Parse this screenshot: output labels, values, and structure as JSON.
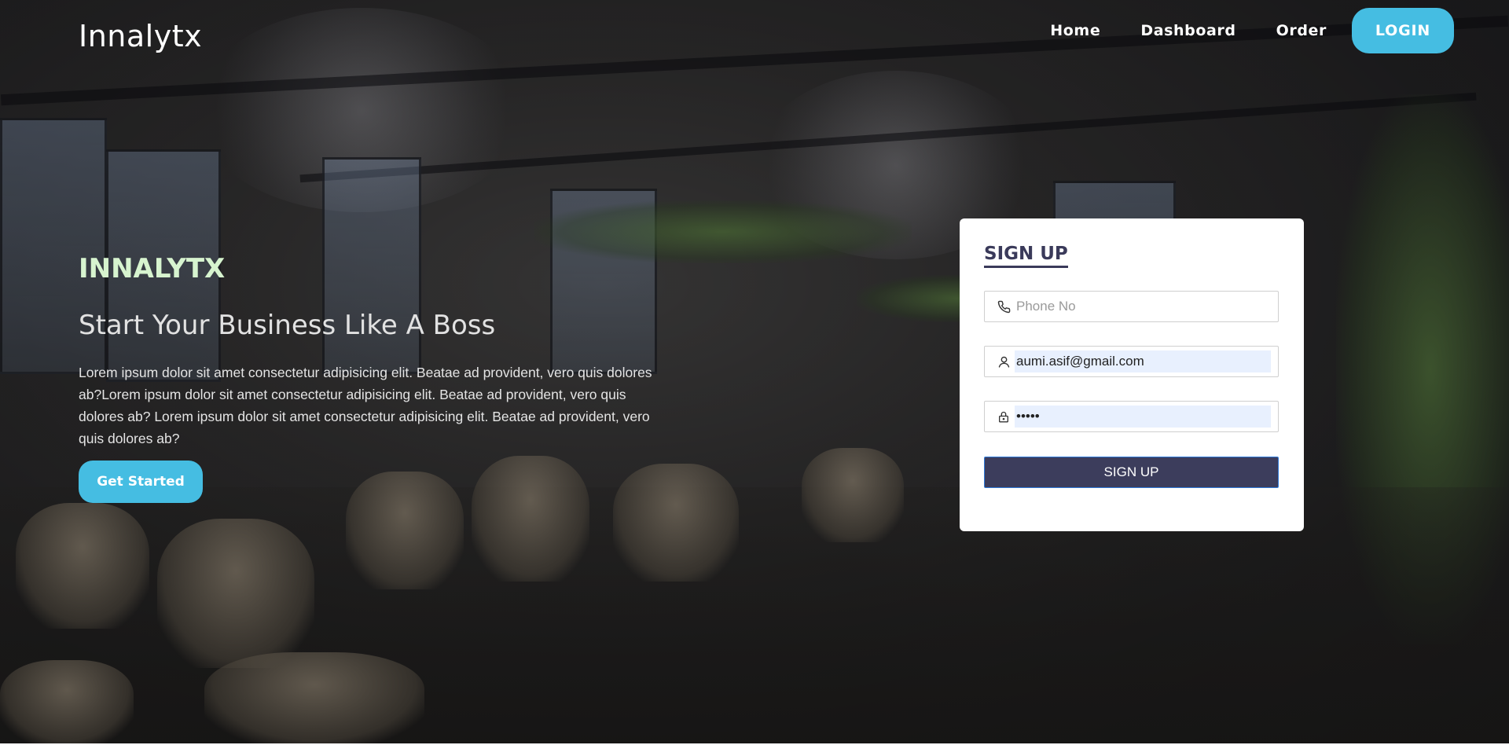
{
  "nav": {
    "logo": "Innalytx",
    "links": [
      "Home",
      "Dashboard",
      "Order"
    ],
    "login_label": "LOGIN"
  },
  "hero": {
    "brand": "INNALYTX",
    "headline": "Start Your Business Like A Boss",
    "body": "Lorem ipsum dolor sit amet consectetur adipisicing elit. Beatae ad provident, vero quis dolores ab?Lorem ipsum dolor sit amet consectetur adipisicing elit. Beatae ad provident, vero quis dolores ab? Lorem ipsum dolor sit amet consectetur adipisicing elit. Beatae ad provident, vero quis dolores ab?",
    "cta_label": "Get Started"
  },
  "signup": {
    "title": "SIGN UP",
    "phone": {
      "placeholder": "Phone No",
      "value": "",
      "icon": "phone-icon"
    },
    "email": {
      "placeholder": "",
      "value": "aumi.asif@gmail.com",
      "icon": "user-icon"
    },
    "password": {
      "placeholder": "",
      "value": "•••••",
      "icon": "lock-icon"
    },
    "submit_label": "SIGN UP"
  },
  "colors": {
    "accent": "#45bde2",
    "brand_title": "#d7f4cf",
    "card_title": "#3a3a5a",
    "submit_bg": "#3c3d5c",
    "autofill_bg": "#e8f0fe"
  }
}
